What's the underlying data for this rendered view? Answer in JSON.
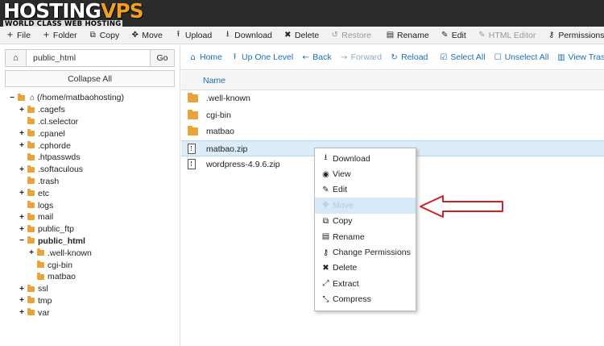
{
  "brand": {
    "logo_main": "HOSTING",
    "logo_accent": "VPS",
    "tagline": "WORLD CLASS WEB HOSTING"
  },
  "toolbar": {
    "items": [
      {
        "icon": "+",
        "label": "File",
        "icon_name": "plus-icon",
        "disabled": false
      },
      {
        "icon": "+",
        "label": "Folder",
        "icon_name": "plus-icon",
        "disabled": false
      },
      {
        "icon": "⧉",
        "label": "Copy",
        "icon_name": "copy-icon",
        "disabled": false
      },
      {
        "icon": "✥",
        "label": "Move",
        "icon_name": "move-icon",
        "disabled": false
      },
      {
        "icon": "⭱",
        "label": "Upload",
        "icon_name": "upload-icon",
        "disabled": false
      },
      {
        "icon": "⭳",
        "label": "Download",
        "icon_name": "download-icon",
        "disabled": false
      },
      {
        "icon": "✖",
        "label": "Delete",
        "icon_name": "delete-icon",
        "disabled": false
      },
      {
        "icon": "↺",
        "label": "Restore",
        "icon_name": "restore-icon",
        "disabled": true
      },
      {
        "icon": "▤",
        "label": "Rename",
        "icon_name": "rename-icon",
        "disabled": false
      },
      {
        "icon": "✎",
        "label": "Edit",
        "icon_name": "edit-icon",
        "disabled": false
      },
      {
        "icon": "✎",
        "label": "HTML Editor",
        "icon_name": "html-editor-icon",
        "disabled": true
      },
      {
        "icon": "⚷",
        "label": "Permissions",
        "icon_name": "key-icon",
        "disabled": false
      },
      {
        "icon": "◉",
        "label": "",
        "icon_name": "eye-icon",
        "disabled": false
      }
    ]
  },
  "left": {
    "home_icon": "⌂",
    "path_value": "public_html",
    "go_label": "Go",
    "collapse_label": "Collapse All",
    "tree": [
      {
        "indent": 0,
        "toggle": "−",
        "type": "home",
        "label": "(/home/matbaohosting)",
        "bold": false
      },
      {
        "indent": 1,
        "toggle": "+",
        "type": "folder",
        "label": ".cagefs",
        "bold": false
      },
      {
        "indent": 1,
        "toggle": "",
        "type": "folder",
        "label": ".cl.selector",
        "bold": false
      },
      {
        "indent": 1,
        "toggle": "+",
        "type": "folder",
        "label": ".cpanel",
        "bold": false
      },
      {
        "indent": 1,
        "toggle": "+",
        "type": "folder",
        "label": ".cphorde",
        "bold": false
      },
      {
        "indent": 1,
        "toggle": "",
        "type": "folder",
        "label": ".htpasswds",
        "bold": false
      },
      {
        "indent": 1,
        "toggle": "+",
        "type": "folder",
        "label": ".softaculous",
        "bold": false
      },
      {
        "indent": 1,
        "toggle": "",
        "type": "folder",
        "label": ".trash",
        "bold": false
      },
      {
        "indent": 1,
        "toggle": "+",
        "type": "folder",
        "label": "etc",
        "bold": false
      },
      {
        "indent": 1,
        "toggle": "",
        "type": "folder",
        "label": "logs",
        "bold": false
      },
      {
        "indent": 1,
        "toggle": "+",
        "type": "folder",
        "label": "mail",
        "bold": false
      },
      {
        "indent": 1,
        "toggle": "+",
        "type": "folder",
        "label": "public_ftp",
        "bold": false
      },
      {
        "indent": 1,
        "toggle": "−",
        "type": "folder",
        "label": "public_html",
        "bold": true
      },
      {
        "indent": 2,
        "toggle": "+",
        "type": "folder",
        "label": ".well-known",
        "bold": false
      },
      {
        "indent": 2,
        "toggle": "",
        "type": "folder",
        "label": "cgi-bin",
        "bold": false
      },
      {
        "indent": 2,
        "toggle": "",
        "type": "folder",
        "label": "matbao",
        "bold": false
      },
      {
        "indent": 1,
        "toggle": "+",
        "type": "folder",
        "label": "ssl",
        "bold": false
      },
      {
        "indent": 1,
        "toggle": "+",
        "type": "folder",
        "label": "tmp",
        "bold": false
      },
      {
        "indent": 1,
        "toggle": "+",
        "type": "folder",
        "label": "var",
        "bold": false
      }
    ]
  },
  "nav": {
    "items": [
      {
        "icon": "⌂",
        "label": "Home",
        "icon_name": "home-icon",
        "disabled": false,
        "sep_after": false
      },
      {
        "icon": "⭱",
        "label": "Up One Level",
        "icon_name": "level-up-icon",
        "disabled": false,
        "sep_after": false
      },
      {
        "icon": "←",
        "label": "Back",
        "icon_name": "back-arrow-icon",
        "disabled": false,
        "sep_after": false
      },
      {
        "icon": "→",
        "label": "Forward",
        "icon_name": "forward-arrow-icon",
        "disabled": true,
        "sep_after": false
      },
      {
        "icon": "↻",
        "label": "Reload",
        "icon_name": "reload-icon",
        "disabled": false,
        "sep_after": false
      },
      {
        "icon": "☑",
        "label": "Select All",
        "icon_name": "select-all-icon",
        "disabled": false,
        "sep_after": false
      },
      {
        "icon": "☐",
        "label": "Unselect All",
        "icon_name": "unselect-all-icon",
        "disabled": false,
        "sep_after": false
      },
      {
        "icon": "▥",
        "label": "View Trash",
        "icon_name": "trash-icon",
        "disabled": false,
        "sep_after": false
      }
    ],
    "column_name": "Name"
  },
  "files": [
    {
      "type": "folder",
      "name": ".well-known",
      "selected": false
    },
    {
      "type": "folder",
      "name": "cgi-bin",
      "selected": false
    },
    {
      "type": "folder",
      "name": "matbao",
      "selected": false
    },
    {
      "type": "zip",
      "name": "matbao.zip",
      "selected": true
    },
    {
      "type": "zip",
      "name": "wordpress-4.9.6.zip",
      "selected": false
    }
  ],
  "context_menu": {
    "items": [
      {
        "icon": "⭳",
        "label": "Download",
        "icon_name": "download-icon",
        "highlighted": false
      },
      {
        "icon": "◉",
        "label": "View",
        "icon_name": "eye-icon",
        "highlighted": false
      },
      {
        "icon": "✎",
        "label": "Edit",
        "icon_name": "pencil-icon",
        "highlighted": false
      },
      {
        "icon": "✥",
        "label": "Move",
        "icon_name": "move-icon",
        "highlighted": true
      },
      {
        "icon": "⧉",
        "label": "Copy",
        "icon_name": "copy-icon",
        "highlighted": false
      },
      {
        "icon": "▤",
        "label": "Rename",
        "icon_name": "rename-icon",
        "highlighted": false
      },
      {
        "icon": "⚷",
        "label": "Change Permissions",
        "icon_name": "key-icon",
        "highlighted": false
      },
      {
        "icon": "✖",
        "label": "Delete",
        "icon_name": "delete-icon",
        "highlighted": false
      },
      {
        "icon": "⤢",
        "label": "Extract",
        "icon_name": "extract-icon",
        "highlighted": false
      },
      {
        "icon": "⤡",
        "label": "Compress",
        "icon_name": "compress-icon",
        "highlighted": false
      }
    ]
  },
  "colors": {
    "link_blue": "#1d6fb0",
    "folder": "#e8a33a",
    "selection": "#dcecf8",
    "annotation_arrow": "#d0202a",
    "logo_accent": "#f0a020"
  }
}
